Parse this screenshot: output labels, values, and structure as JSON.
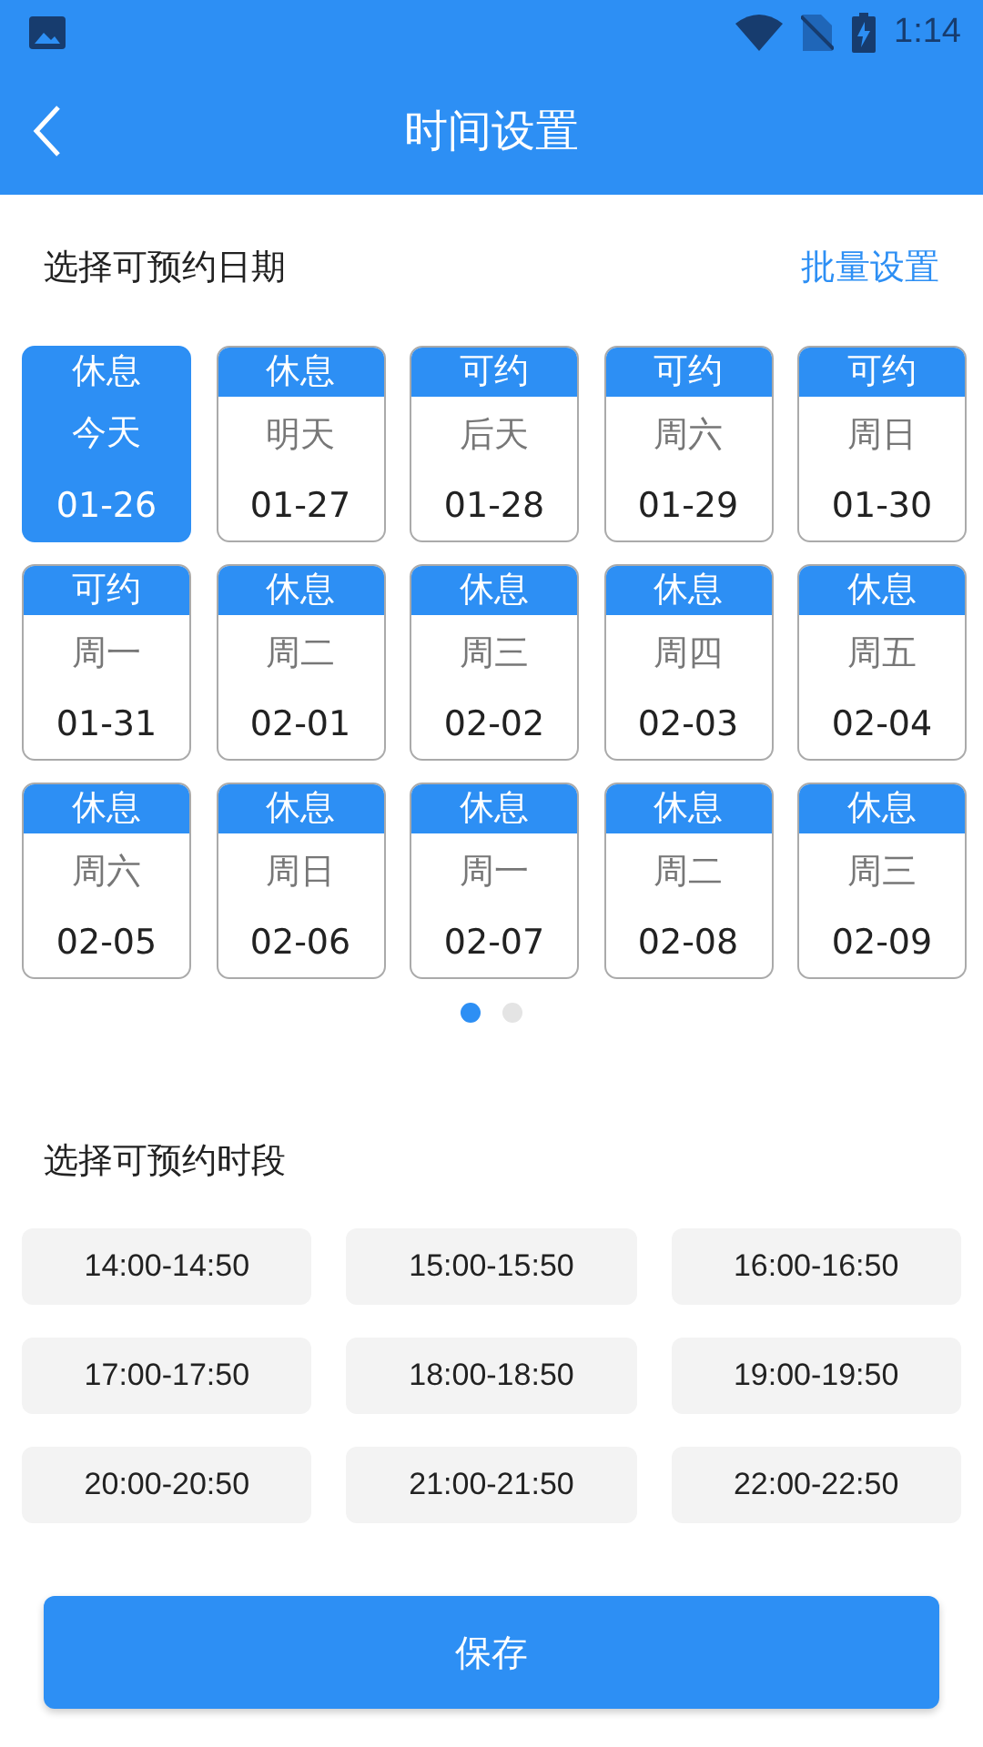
{
  "status_bar": {
    "time": "1:14"
  },
  "header": {
    "title": "时间设置"
  },
  "dates_section": {
    "title": "选择可预约日期",
    "action": "批量设置"
  },
  "dates": [
    {
      "status": "休息",
      "day": "今天",
      "date": "01-26",
      "selected": true
    },
    {
      "status": "休息",
      "day": "明天",
      "date": "01-27",
      "selected": false
    },
    {
      "status": "可约",
      "day": "后天",
      "date": "01-28",
      "selected": false
    },
    {
      "status": "可约",
      "day": "周六",
      "date": "01-29",
      "selected": false
    },
    {
      "status": "可约",
      "day": "周日",
      "date": "01-30",
      "selected": false
    },
    {
      "status": "可约",
      "day": "周一",
      "date": "01-31",
      "selected": false
    },
    {
      "status": "休息",
      "day": "周二",
      "date": "02-01",
      "selected": false
    },
    {
      "status": "休息",
      "day": "周三",
      "date": "02-02",
      "selected": false
    },
    {
      "status": "休息",
      "day": "周四",
      "date": "02-03",
      "selected": false
    },
    {
      "status": "休息",
      "day": "周五",
      "date": "02-04",
      "selected": false
    },
    {
      "status": "休息",
      "day": "周六",
      "date": "02-05",
      "selected": false
    },
    {
      "status": "休息",
      "day": "周日",
      "date": "02-06",
      "selected": false
    },
    {
      "status": "休息",
      "day": "周一",
      "date": "02-07",
      "selected": false
    },
    {
      "status": "休息",
      "day": "周二",
      "date": "02-08",
      "selected": false
    },
    {
      "status": "休息",
      "day": "周三",
      "date": "02-09",
      "selected": false
    }
  ],
  "pages": [
    {
      "selected": true
    },
    {
      "selected": false
    }
  ],
  "slots_section": {
    "title": "选择可预约时段"
  },
  "slots": [
    "14:00-14:50",
    "15:00-15:50",
    "16:00-16:50",
    "17:00-17:50",
    "18:00-18:50",
    "19:00-19:50",
    "20:00-20:50",
    "21:00-21:50",
    "22:00-22:50"
  ],
  "save_button": "保存"
}
